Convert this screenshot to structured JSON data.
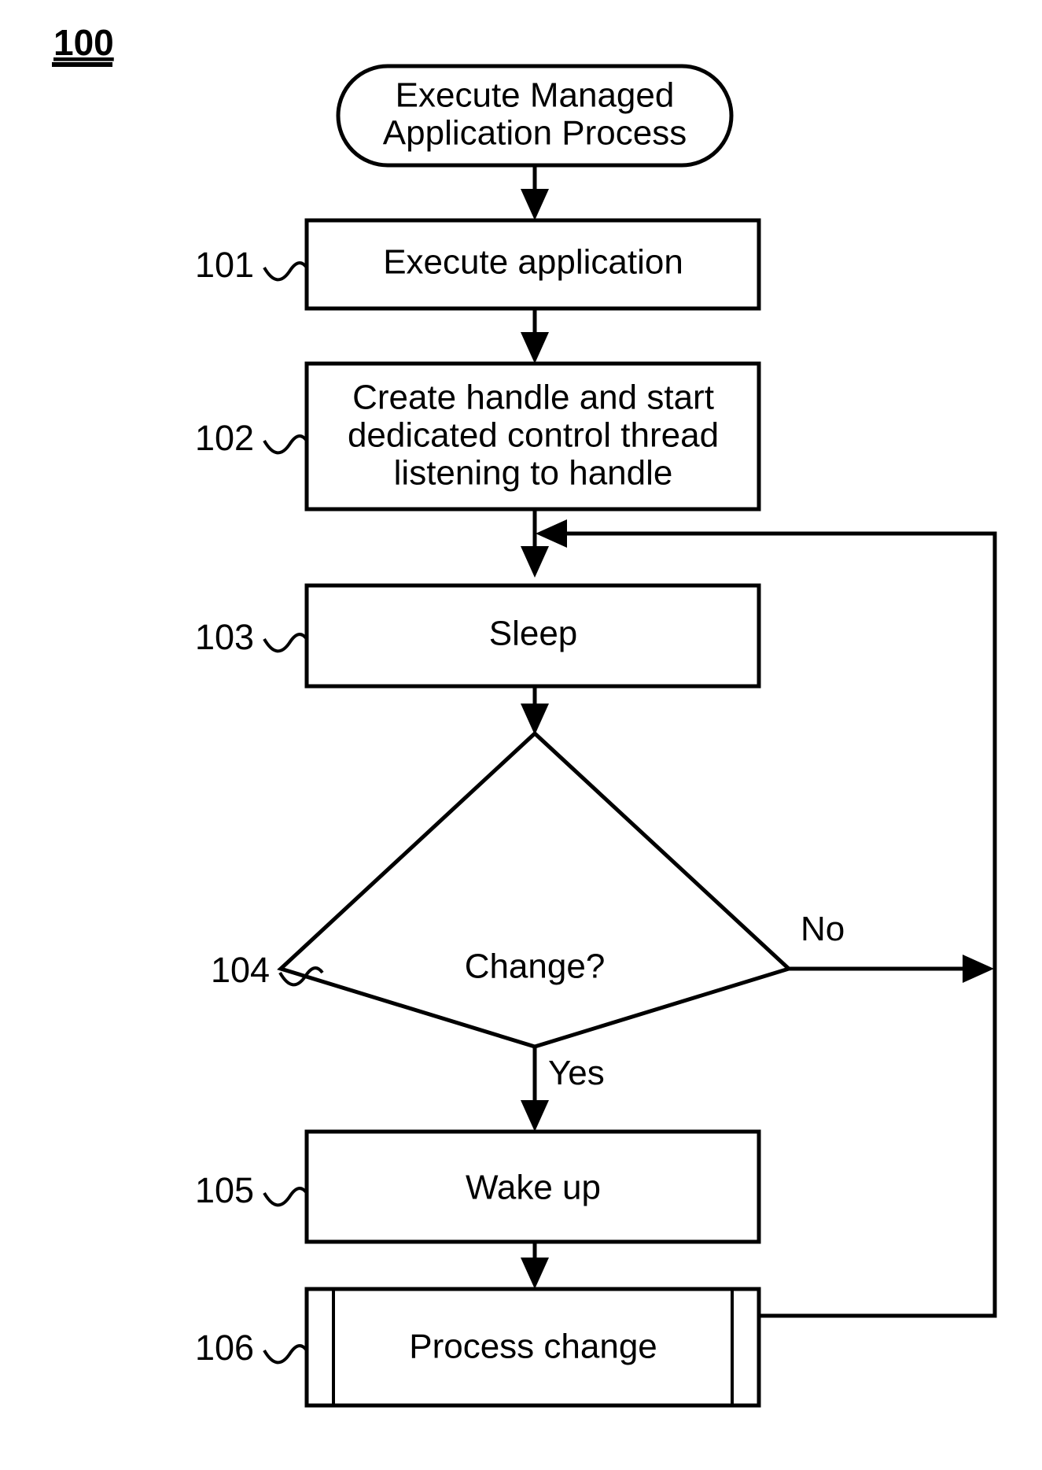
{
  "figure": {
    "number": "100",
    "title_underlined": true
  },
  "nodes": [
    {
      "id": "start",
      "shape": "stadium",
      "ref": "",
      "lines": [
        "Execute Managed",
        "Application Process"
      ]
    },
    {
      "id": "step-101",
      "shape": "process",
      "ref": "101",
      "lines": [
        "Execute application"
      ]
    },
    {
      "id": "step-102",
      "shape": "process",
      "ref": "102",
      "lines": [
        "Create handle and start",
        "dedicated control thread",
        "listening to handle"
      ]
    },
    {
      "id": "step-103",
      "shape": "process",
      "ref": "103",
      "lines": [
        "Sleep"
      ]
    },
    {
      "id": "step-104",
      "shape": "decision",
      "ref": "104",
      "lines": [
        "Change?"
      ]
    },
    {
      "id": "step-105",
      "shape": "process",
      "ref": "105",
      "lines": [
        "Wake up"
      ]
    },
    {
      "id": "step-106",
      "shape": "predefined-process",
      "ref": "106",
      "lines": [
        "Process change"
      ]
    }
  ],
  "branches": {
    "no_label": "No",
    "yes_label": "Yes"
  },
  "colors": {
    "ink": "#000000",
    "paper": "#ffffff"
  }
}
